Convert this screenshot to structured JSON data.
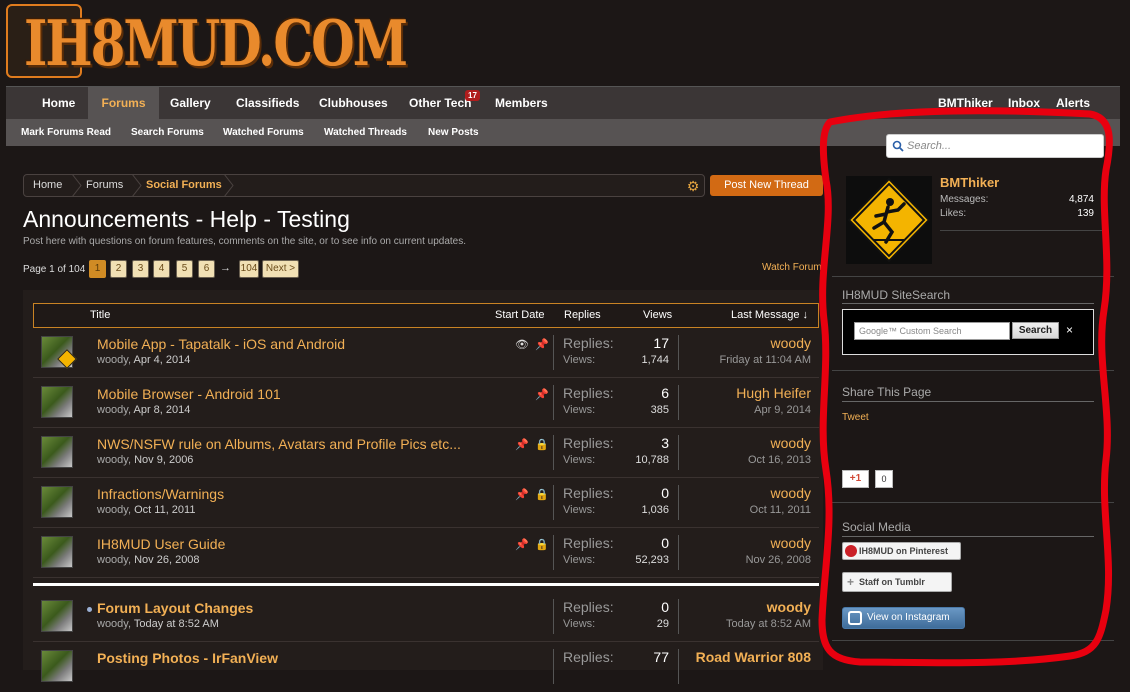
{
  "logo": {
    "text": "IH8MUD.COM"
  },
  "nav": {
    "items": [
      {
        "label": "Home"
      },
      {
        "label": "Forums"
      },
      {
        "label": "Gallery"
      },
      {
        "label": "Classifieds"
      },
      {
        "label": "Clubhouses"
      },
      {
        "label": "Other Tech"
      },
      {
        "label": "Members"
      }
    ],
    "other_tech_badge": "17",
    "user_items": [
      {
        "label": "BMThiker"
      },
      {
        "label": "Inbox"
      },
      {
        "label": "Alerts"
      }
    ]
  },
  "subnav": {
    "items": [
      {
        "label": "Mark Forums Read"
      },
      {
        "label": "Search Forums"
      },
      {
        "label": "Watched Forums"
      },
      {
        "label": "Watched Threads"
      },
      {
        "label": "New Posts"
      }
    ]
  },
  "breadcrumb": {
    "items": [
      {
        "label": "Home"
      },
      {
        "label": "Forums"
      },
      {
        "label": "Social Forums"
      }
    ]
  },
  "buttons": {
    "new_thread": "Post New Thread",
    "watch_forum": "Watch Forum"
  },
  "forum": {
    "title": "Announcements - Help - Testing",
    "description": "Post here with questions on forum features, comments on the site, or to see info on current updates."
  },
  "pagination": {
    "label": "Page 1 of 104",
    "pages": [
      "1",
      "2",
      "3",
      "4",
      "5",
      "6"
    ],
    "arrow": "→",
    "last": "104",
    "next": "Next >",
    "current_page": 1
  },
  "table": {
    "headers": {
      "title": "Title",
      "start_date": "Start Date",
      "replies": "Replies",
      "views": "Views",
      "last_message": "Last Message ↓"
    },
    "replies_label": "Replies:",
    "views_label": "Views:",
    "sticky_threads": [
      {
        "title": "Mobile App - Tapatalk - iOS and Android",
        "author": "woody",
        "date": "Apr 4, 2014",
        "replies": "17",
        "views": "1,744",
        "last_user": "woody",
        "last_date": "Friday at 11:04 AM",
        "icons": [
          "eye-icon",
          "pin-icon"
        ]
      },
      {
        "title": "Mobile Browser - Android 101",
        "author": "woody",
        "date": "Apr 8, 2014",
        "replies": "6",
        "views": "385",
        "last_user": "Hugh Heifer",
        "last_date": "Apr 9, 2014",
        "icons": [
          "pin-icon"
        ]
      },
      {
        "title": "NWS/NSFW rule on Albums, Avatars and Profile Pics etc...",
        "author": "woody",
        "date": "Nov 9, 2006",
        "replies": "3",
        "views": "10,788",
        "last_user": "woody",
        "last_date": "Oct 16, 2013",
        "icons": [
          "pin-icon",
          "lock-icon"
        ]
      },
      {
        "title": "Infractions/Warnings",
        "author": "woody",
        "date": "Oct 11, 2011",
        "replies": "0",
        "views": "1,036",
        "last_user": "woody",
        "last_date": "Oct 11, 2011",
        "icons": [
          "pin-icon",
          "lock-icon"
        ]
      },
      {
        "title": "IH8MUD User Guide",
        "author": "woody",
        "date": "Nov 26, 2008",
        "replies": "0",
        "views": "52,293",
        "last_user": "woody",
        "last_date": "Nov 26, 2008",
        "icons": [
          "pin-icon",
          "lock-icon"
        ]
      }
    ],
    "threads": [
      {
        "title": "Forum Layout Changes",
        "author": "woody",
        "date": "Today at 8:52 AM",
        "replies": "0",
        "views": "29",
        "last_user": "woody",
        "last_date": "Today at 8:52 AM"
      },
      {
        "title": "Posting Photos - IrFanView",
        "author": "",
        "date": "",
        "replies": "77",
        "views": "",
        "last_user": "Road Warrior 808",
        "last_date": ""
      }
    ]
  },
  "sidebar": {
    "search_placeholder": "Search...",
    "user": {
      "name": "BMThiker",
      "messages_label": "Messages:",
      "messages": "4,874",
      "likes_label": "Likes:",
      "likes": "139"
    },
    "site_search": {
      "heading": "IH8MUD SiteSearch",
      "placeholder": "Google™ Custom Search",
      "button": "Search",
      "clear": "×"
    },
    "share": {
      "heading": "Share This Page",
      "tweet": "Tweet",
      "gplus": "+1",
      "gplus_count": "0"
    },
    "social": {
      "heading": "Social Media",
      "pinterest": "IH8MUD on Pinterest",
      "tumblr": "Staff on Tumblr",
      "instagram": "View on Instagram"
    }
  },
  "colors": {
    "accent": "#f2b055",
    "button": "#d26a14",
    "annotation": "#e8000f"
  }
}
